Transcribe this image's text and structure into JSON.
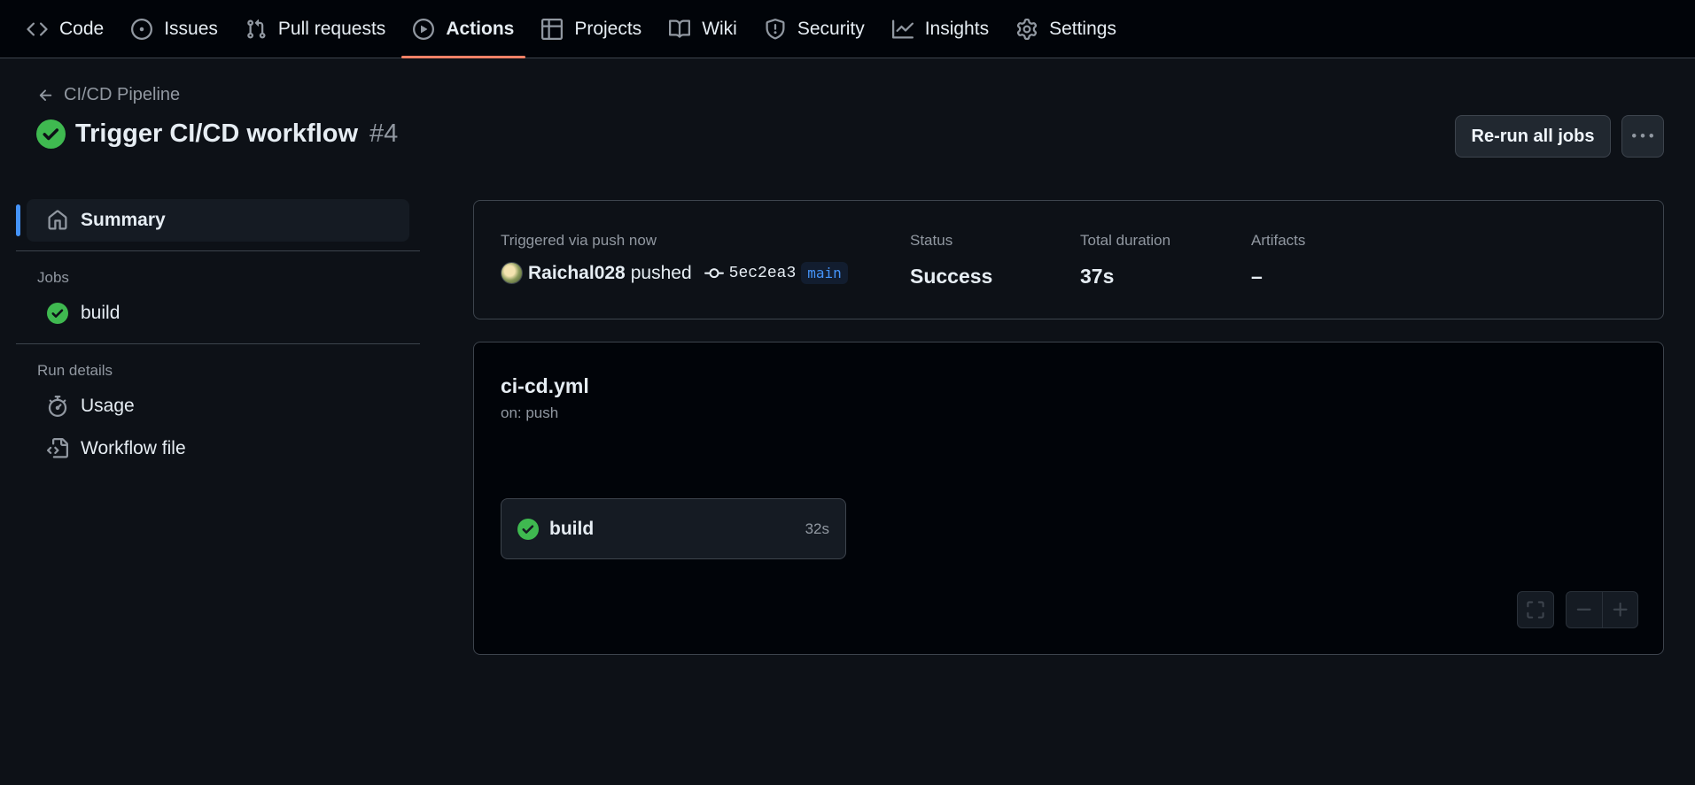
{
  "nav": {
    "tabs": [
      {
        "label": "Code",
        "icon": "code-icon"
      },
      {
        "label": "Issues",
        "icon": "issue-opened-icon"
      },
      {
        "label": "Pull requests",
        "icon": "git-pull-request-icon"
      },
      {
        "label": "Actions",
        "icon": "play-icon",
        "active": true
      },
      {
        "label": "Projects",
        "icon": "table-icon"
      },
      {
        "label": "Wiki",
        "icon": "book-icon"
      },
      {
        "label": "Security",
        "icon": "shield-icon"
      },
      {
        "label": "Insights",
        "icon": "graph-icon"
      },
      {
        "label": "Settings",
        "icon": "gear-icon"
      }
    ],
    "accent_color": "#f78166"
  },
  "header": {
    "back_label": "CI/CD Pipeline",
    "title": "Trigger CI/CD workflow",
    "run_number": "#4",
    "rerun_label": "Re-run all jobs",
    "status_color": "#3fb950"
  },
  "sidebar": {
    "summary_label": "Summary",
    "jobs_heading": "Jobs",
    "jobs": [
      {
        "label": "build",
        "status": "success"
      }
    ],
    "run_details_heading": "Run details",
    "details": [
      {
        "label": "Usage",
        "icon": "stopwatch-icon"
      },
      {
        "label": "Workflow file",
        "icon": "file-code-icon"
      }
    ],
    "selected_color": "#4493f8"
  },
  "summary": {
    "trigger_label": "Triggered via push now",
    "actor": "Raichal028",
    "action": "pushed",
    "commit": "5ec2ea3",
    "branch": "main",
    "status_label": "Status",
    "status_value": "Success",
    "duration_label": "Total duration",
    "duration_value": "37s",
    "artifacts_label": "Artifacts",
    "artifacts_value": "–"
  },
  "graph": {
    "workflow_file": "ci-cd.yml",
    "trigger": "on: push",
    "job": {
      "name": "build",
      "duration": "32s",
      "status": "success"
    }
  }
}
